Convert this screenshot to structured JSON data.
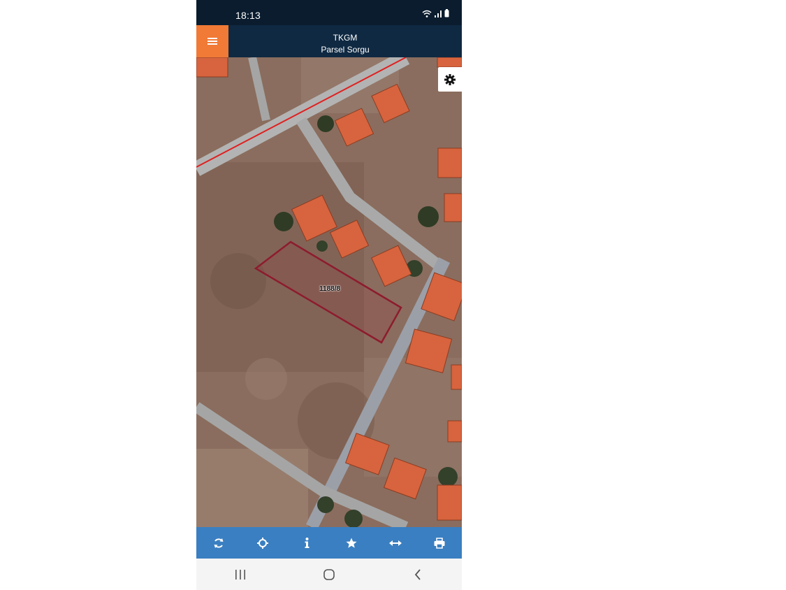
{
  "status_bar": {
    "time": "18:13"
  },
  "header": {
    "title": "TKGM",
    "subtitle": "Parsel Sorgu"
  },
  "map": {
    "parcel_label": "1188/8"
  },
  "toolbar": {
    "icons": [
      "refresh-icon",
      "locate-icon",
      "info-icon",
      "star-icon",
      "measure-icon",
      "print-icon"
    ]
  },
  "navigation": {
    "icons": [
      "recent-apps-icon",
      "home-icon",
      "back-icon"
    ]
  },
  "colors": {
    "menu_button": "#f07a36",
    "header_bg": "#0f2942",
    "toolbar_bg": "#3a7fc1",
    "parcel_outline": "#8e1b2e",
    "boundary_line": "#e02020"
  }
}
